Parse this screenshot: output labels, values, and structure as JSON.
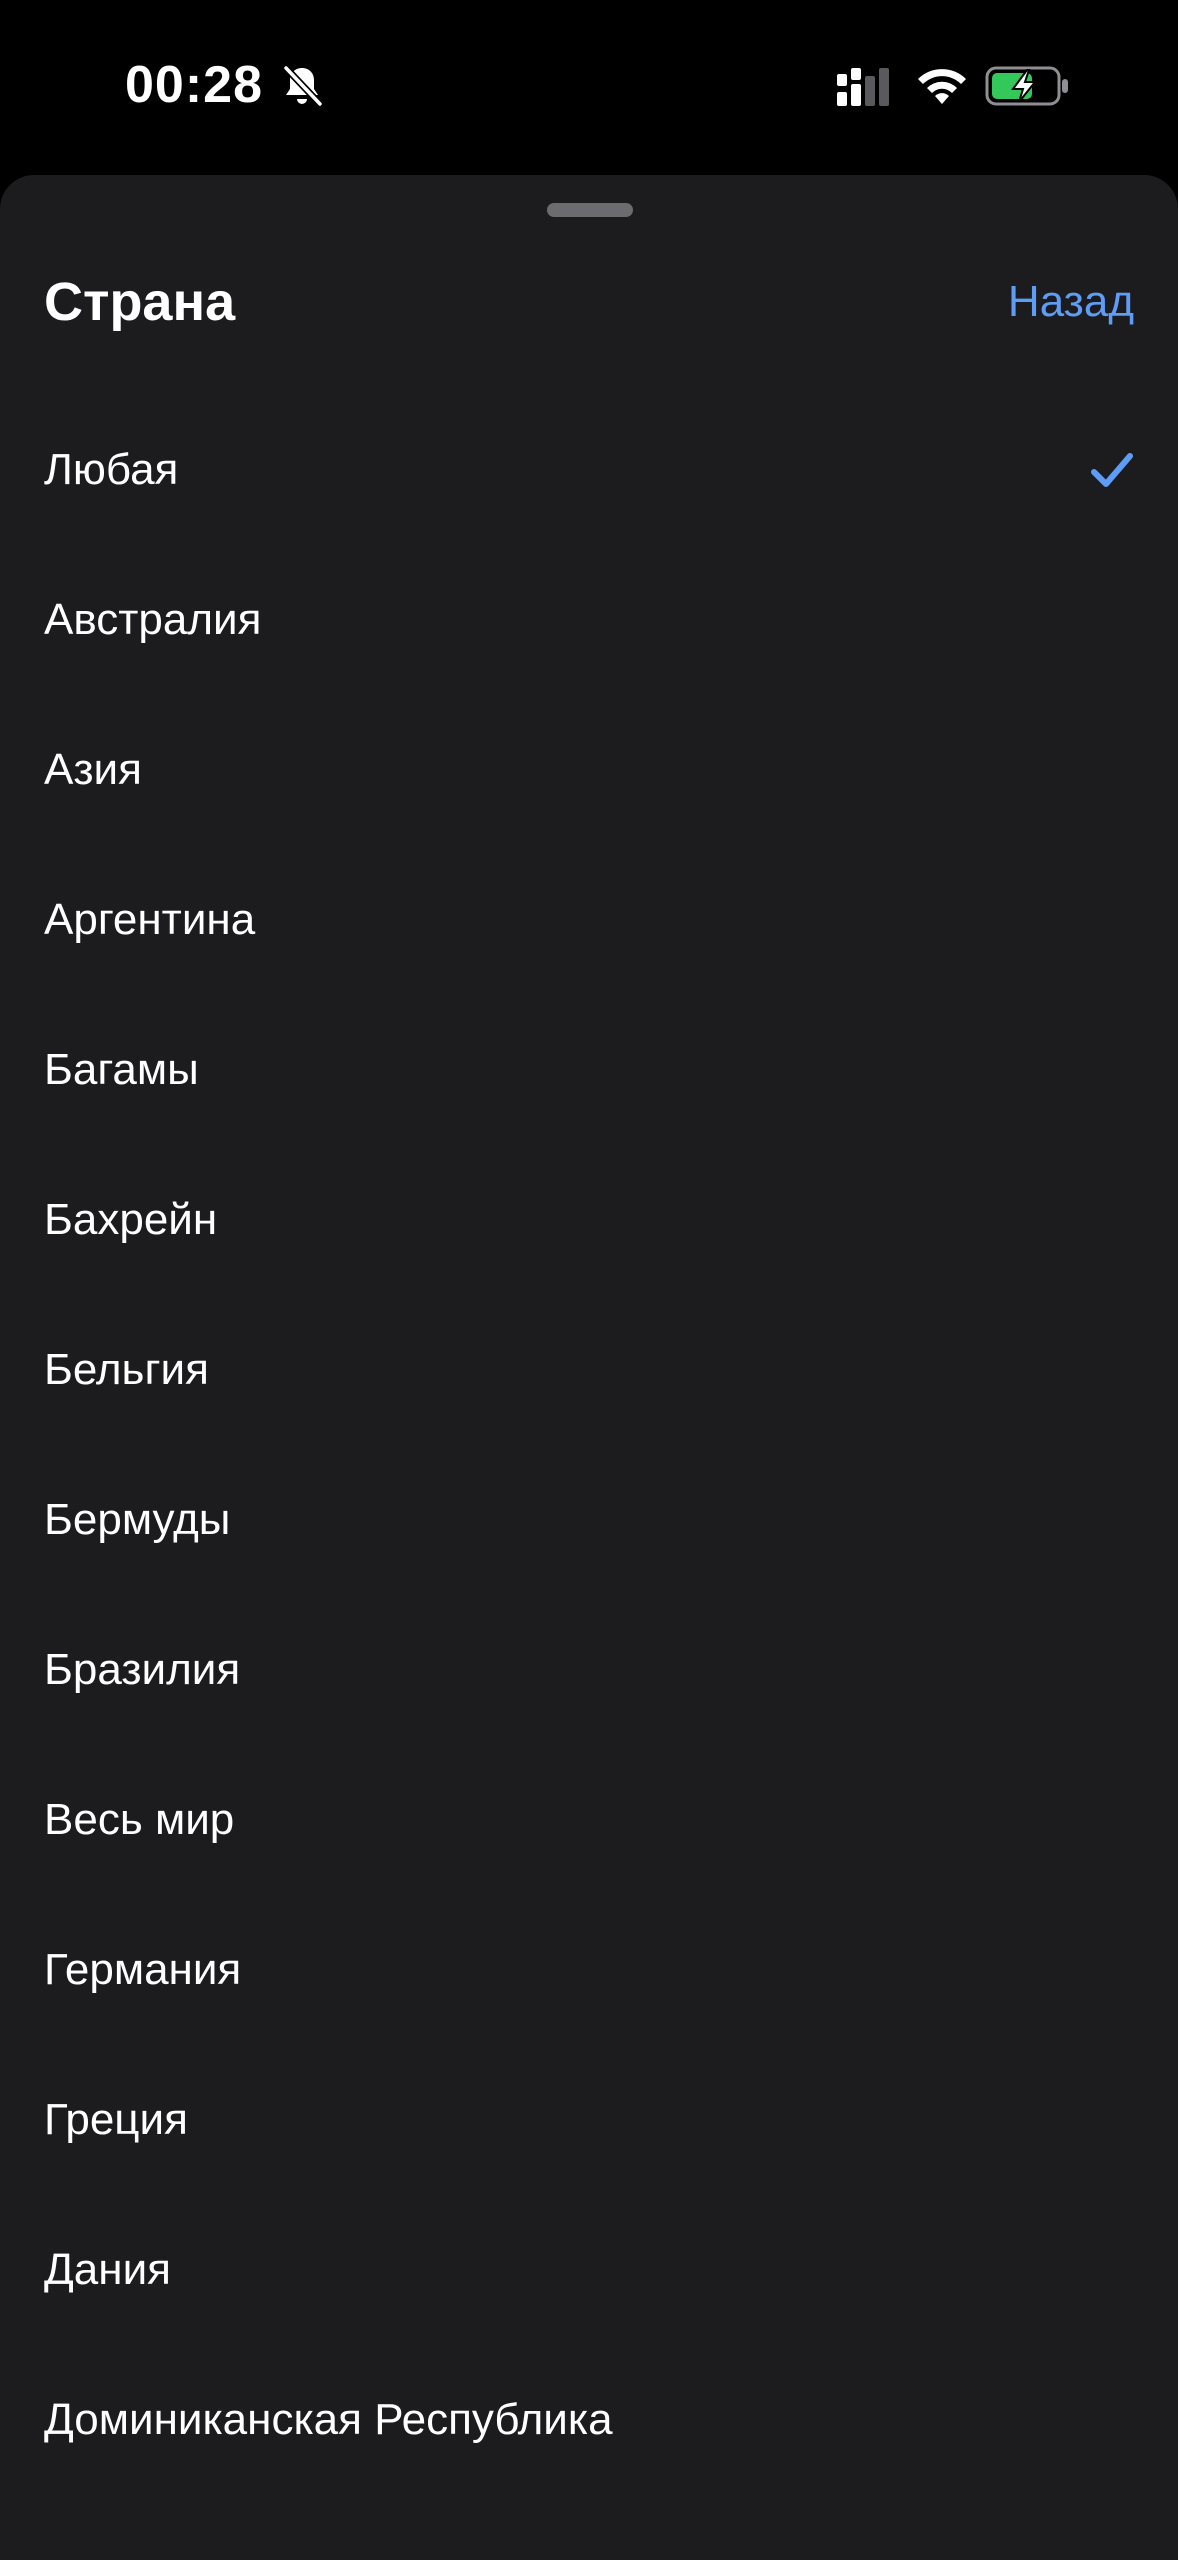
{
  "status_bar": {
    "time": "00:28",
    "icons": [
      "bell-slash-icon",
      "cellular-signal-icon",
      "wifi-icon",
      "battery-charging-icon"
    ]
  },
  "sheet": {
    "title": "Страна",
    "back_label": "Назад"
  },
  "countries": [
    {
      "label": "Любая",
      "selected": true
    },
    {
      "label": "Австралия",
      "selected": false
    },
    {
      "label": "Азия",
      "selected": false
    },
    {
      "label": "Аргентина",
      "selected": false
    },
    {
      "label": "Багамы",
      "selected": false
    },
    {
      "label": "Бахрейн",
      "selected": false
    },
    {
      "label": "Бельгия",
      "selected": false
    },
    {
      "label": "Бермуды",
      "selected": false
    },
    {
      "label": "Бразилия",
      "selected": false
    },
    {
      "label": "Весь мир",
      "selected": false
    },
    {
      "label": "Германия",
      "selected": false
    },
    {
      "label": "Греция",
      "selected": false
    },
    {
      "label": "Дания",
      "selected": false
    },
    {
      "label": "Доминиканская Республика",
      "selected": false
    }
  ],
  "colors": {
    "background": "#000000",
    "sheet": "#1c1c1e",
    "accent": "#5e9cf5",
    "battery": "#34c759"
  }
}
